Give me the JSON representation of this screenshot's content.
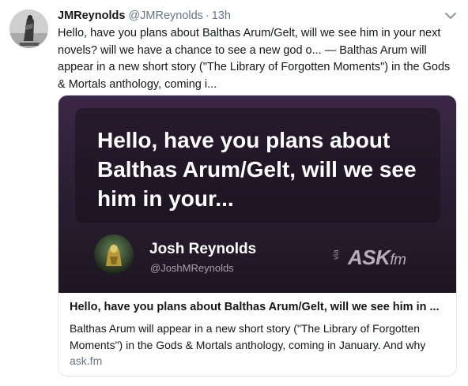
{
  "tweet": {
    "author_name": "JMReynolds",
    "author_handle": "@JMReynolds",
    "separator": "·",
    "time": "13h",
    "text": "Hello, have you plans about Balthas Arum/Gelt, will we see him in your next novels? will we have a chance to see a new god o... — Balthas Arum will appear in a new short story (\"The Library of Forgotten Moments\") in the Gods & Mortals anthology, coming i..."
  },
  "card": {
    "image": {
      "question": "Hello, have you plans about Balthas Arum/Gelt, will we see him in your...",
      "author_name": "Josh Reynolds",
      "author_handle": "@JoshMReynolds",
      "via_label": "via",
      "brand_ask": "ASK",
      "brand_fm": "fm"
    },
    "title": "Hello, have you plans about Balthas Arum/Gelt, will we see him in ...",
    "description": "Balthas Arum will appear in a new short story (\"The Library of Forgotten Moments\") in the Gods & Mortals anthology, coming in January. And why",
    "domain": "ask.fm"
  },
  "icons": {
    "caret": "chevron-down-icon"
  },
  "colors": {
    "text": "#14171a",
    "muted": "#657786",
    "border": "#e1e8ed",
    "card_bg": "#2b1f33"
  }
}
